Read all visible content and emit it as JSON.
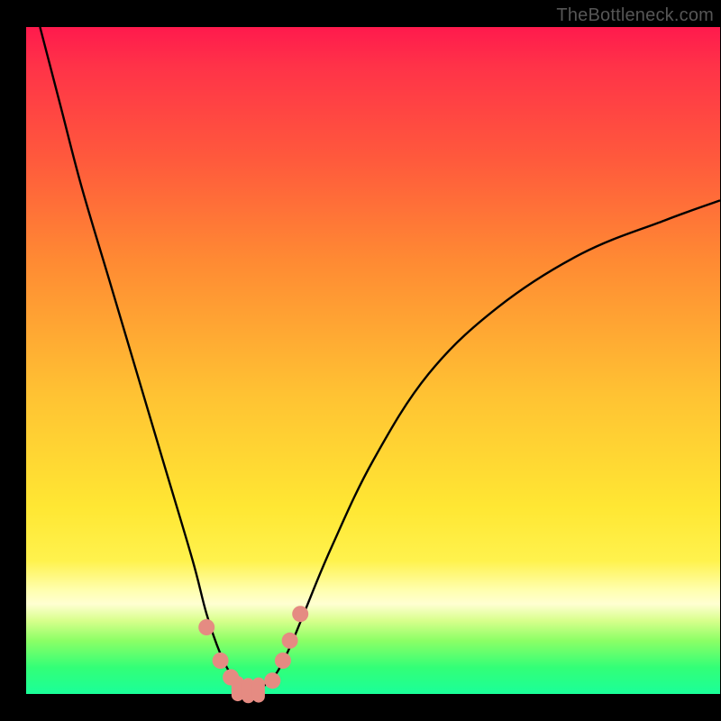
{
  "attribution": "TheBottleneck.com",
  "colors": {
    "gradient_top": "#ff1a4d",
    "gradient_mid": "#ffe733",
    "gradient_bottom": "#1aff99",
    "curve": "#000000",
    "markers": "#e58b82",
    "frame": "#000000"
  },
  "chart_data": {
    "type": "line",
    "title": "",
    "xlabel": "",
    "ylabel": "",
    "xlim": [
      0,
      100
    ],
    "ylim": [
      0,
      100
    ],
    "grid": false,
    "legend": false,
    "series": [
      {
        "name": "bottleneck-curve",
        "x": [
          2,
          5,
          8,
          12,
          16,
          20,
          24,
          26,
          28,
          30,
          31,
          32,
          33,
          34,
          36,
          38,
          40,
          44,
          50,
          58,
          68,
          80,
          92,
          100
        ],
        "y": [
          100,
          88,
          76,
          62,
          48,
          34,
          20,
          12,
          6,
          2,
          0.8,
          0.5,
          0.5,
          1,
          3,
          7,
          12,
          22,
          35,
          48,
          58,
          66,
          71,
          74
        ]
      }
    ],
    "markers": {
      "name": "salmon-markers",
      "points": [
        {
          "x": 26.0,
          "y": 10.0,
          "kind": "dot"
        },
        {
          "x": 28.0,
          "y": 5.0,
          "kind": "dot"
        },
        {
          "x": 29.5,
          "y": 2.5,
          "kind": "dot"
        },
        {
          "x": 30.5,
          "y": 0.8,
          "kind": "bar"
        },
        {
          "x": 32.0,
          "y": 0.5,
          "kind": "bar"
        },
        {
          "x": 33.5,
          "y": 0.6,
          "kind": "bar"
        },
        {
          "x": 35.5,
          "y": 2.0,
          "kind": "dot"
        },
        {
          "x": 37.0,
          "y": 5.0,
          "kind": "dot"
        },
        {
          "x": 38.0,
          "y": 8.0,
          "kind": "dot"
        },
        {
          "x": 39.5,
          "y": 12.0,
          "kind": "dot"
        }
      ]
    }
  }
}
